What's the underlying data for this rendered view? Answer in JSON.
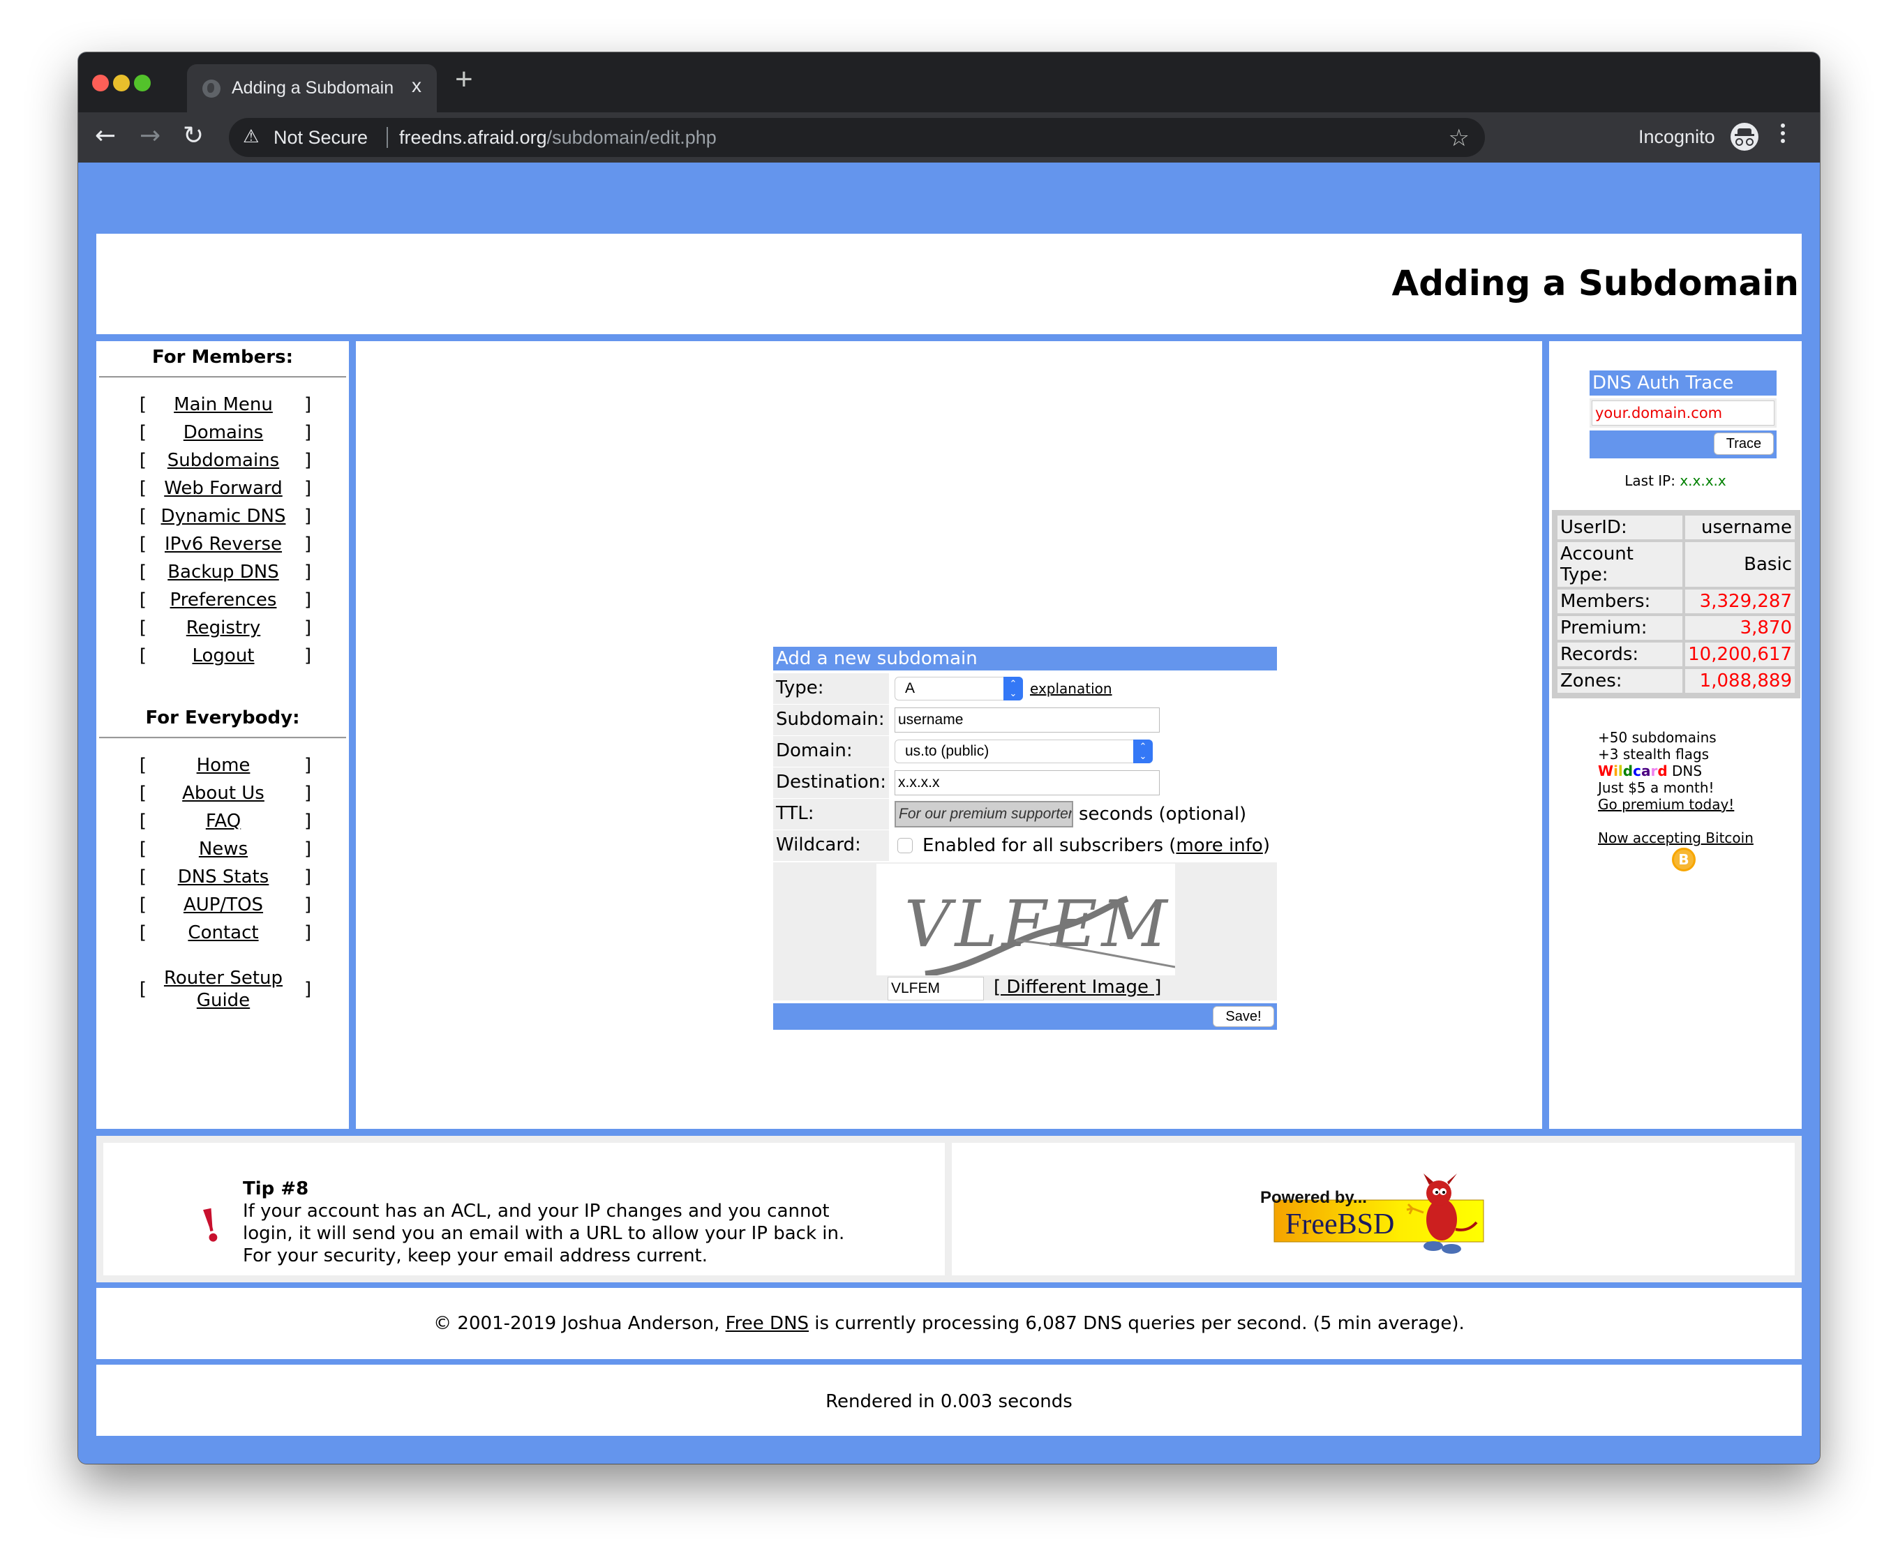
{
  "browser": {
    "tab_title": "Adding a Subdomain",
    "tab_close": "x",
    "new_tab": "+",
    "security_label": "Not Secure",
    "url_host": "freedns.afraid.org",
    "url_path": "/subdomain/edit.php",
    "profile_label": "Incognito",
    "icons": [
      "back-arrow",
      "forward-arrow",
      "reload",
      "warning-triangle",
      "star",
      "incognito",
      "menu-dots"
    ]
  },
  "header": {
    "title": "Adding a Subdomain"
  },
  "sidebar": {
    "members_heading": "For Members:",
    "members_items": [
      "Main Menu",
      "Domains",
      "Subdomains",
      "Web Forward",
      "Dynamic DNS",
      "IPv6 Reverse",
      "Backup DNS",
      "Preferences",
      "Registry",
      "Logout"
    ],
    "everybody_heading": "For Everybody:",
    "everybody_items": [
      "Home",
      "About Us",
      "FAQ",
      "News",
      "DNS Stats",
      "AUP/TOS",
      "Contact"
    ],
    "router_guide": "Router Setup Guide",
    "bracket_open": "[",
    "bracket_close": "]"
  },
  "form": {
    "heading": "Add a new subdomain",
    "type_label": "Type:",
    "type_value": "A",
    "explanation_link": "explanation",
    "subdomain_label": "Subdomain:",
    "subdomain_value": "username",
    "domain_label": "Domain:",
    "domain_value": "us.to (public)",
    "destination_label": "Destination:",
    "destination_value": "x.x.x.x",
    "ttl_label": "TTL:",
    "ttl_placeholder": "For our premium supporters",
    "ttl_suffix": "seconds (optional)",
    "wildcard_label": "Wildcard:",
    "wildcard_checked": false,
    "wildcard_text": "Enabled for all subscribers (",
    "wildcard_more": "more info",
    "wildcard_close": ")",
    "captcha_text": "VLFEM",
    "captcha_value": "VLFEM",
    "different_image": "[ Different Image ]",
    "save_label": "Save!"
  },
  "trace": {
    "heading": "DNS Auth Trace",
    "input_value": "your.domain.com",
    "button_label": "Trace",
    "last_ip_label": "Last IP:",
    "last_ip_value": "x.x.x.x"
  },
  "account": {
    "rows": [
      {
        "label": "UserID:",
        "value": "username",
        "highlight": false
      },
      {
        "label": "Account Type:",
        "value": "Basic",
        "highlight": false
      },
      {
        "label": "Members:",
        "value": "3,329,287",
        "highlight": true
      },
      {
        "label": "Premium:",
        "value": "3,870",
        "highlight": true
      },
      {
        "label": "Records:",
        "value": "10,200,617",
        "highlight": true
      },
      {
        "label": "Zones:",
        "value": "1,088,889",
        "highlight": true
      }
    ]
  },
  "promo": {
    "line1": "+50 subdomains",
    "line2": "+3 stealth flags",
    "wildcard_word": [
      "W",
      "i",
      "l",
      "d",
      "c",
      "a",
      "r",
      "d"
    ],
    "wildcard_colors": [
      "#ff0000",
      "#ffa500",
      "#cccc00",
      "#008000",
      "#0000ff",
      "#4b0082",
      "#ee82ee",
      "#ff0000"
    ],
    "line3_suffix": " DNS",
    "line4": "Just $5 a month!",
    "premium_link": "Go premium today!",
    "bitcoin_link": "Now accepting Bitcoin",
    "bitcoin_symbol": "B"
  },
  "tip": {
    "title": "Tip #8",
    "lines": [
      "If your account has an ACL, and your IP changes and you cannot",
      "login, it will send you an email with a URL to allow your IP back in.",
      "For your security, keep your email address current."
    ],
    "icon": "!"
  },
  "powered": {
    "top": "Powered by...",
    "name": "FreeBSD"
  },
  "footer": {
    "copyright_prefix": "© 2001-2019 Joshua Anderson, ",
    "copyright_link": "Free DNS",
    "copyright_suffix": " is currently processing 6,087 DNS queries per second. (5 min average).",
    "rendered": "Rendered in 0.003 seconds"
  },
  "colors": {
    "accent": "#6495ed",
    "stat_red": "#ff0000",
    "ip_green": "#008000",
    "cell_gray": "#eeeeee"
  }
}
